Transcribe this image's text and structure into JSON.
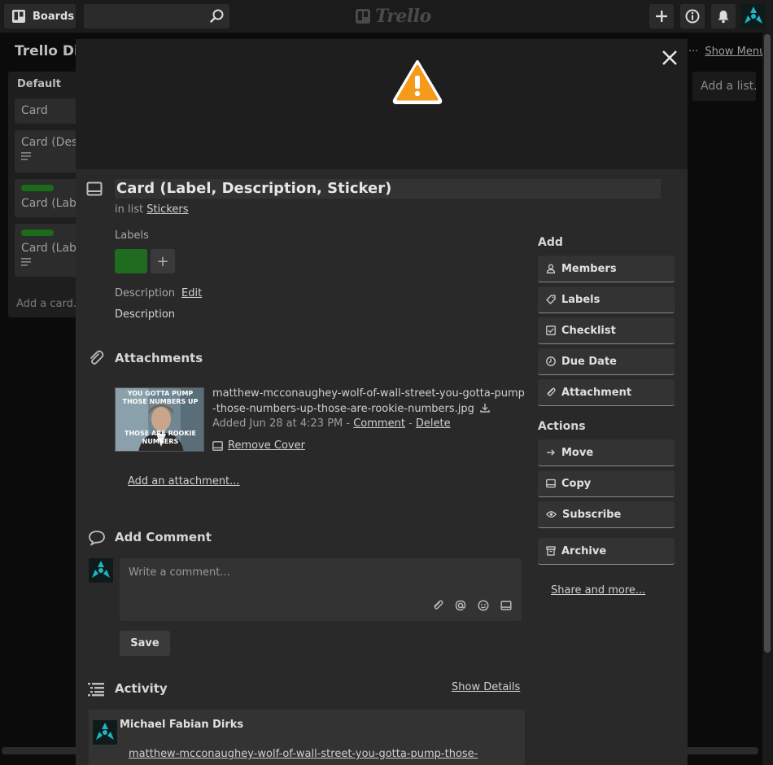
{
  "header": {
    "boards_label": "Boards",
    "logo_text": "Trello"
  },
  "board": {
    "title": "Trello Dig",
    "show_menu": "Show Menu",
    "add_list": "Add a list...",
    "list": {
      "name": "Default",
      "cards": [
        "Card",
        "Card (Desc",
        "Card (Labe",
        "Card (Labe"
      ],
      "add_card": "Add a card..."
    }
  },
  "modal": {
    "title": "Card (Label, Description, Sticker)",
    "in_list_prefix": "in list",
    "in_list_name": "Stickers",
    "labels_title": "Labels",
    "label_add": "+",
    "description_title": "Description",
    "description_edit": "Edit",
    "description_text": "Description",
    "attachments_title": "Attachments",
    "attachment": {
      "thumb_top": "YOU GOTTA PUMP THOSE NUMBERS UP",
      "thumb_bottom": "THOSE ARE ROOKIE NUMBERS",
      "filename": "matthew-mcconaughey-wolf-of-wall-street-you-gotta-pump-those-numbers-up-those-are-rookie-numbers.jpg",
      "added": "Added Jun 28 at 4:23 PM -",
      "comment": "Comment",
      "separator": "-",
      "delete": "Delete",
      "remove_cover": "Remove Cover"
    },
    "add_attachment": "Add an attachment...",
    "add_comment_title": "Add Comment",
    "comment_placeholder": "Write a comment...",
    "save": "Save",
    "activity_title": "Activity",
    "show_details": "Show Details",
    "activity_item": {
      "author": "Michael Fabian Dirks",
      "link": "matthew-mcconaughey-wolf-of-wall-street-you-gotta-pump-those-"
    }
  },
  "sidebar": {
    "add_title": "Add",
    "add_buttons": [
      "Members",
      "Labels",
      "Checklist",
      "Due Date",
      "Attachment"
    ],
    "actions_title": "Actions",
    "action_buttons": [
      "Move",
      "Copy",
      "Subscribe",
      "Archive"
    ],
    "share": "Share and more..."
  },
  "colors": {
    "label_green": "#1f6b1f",
    "sticker_orange": "#f59a1b",
    "avatar_teal": "#1fb5c2"
  }
}
